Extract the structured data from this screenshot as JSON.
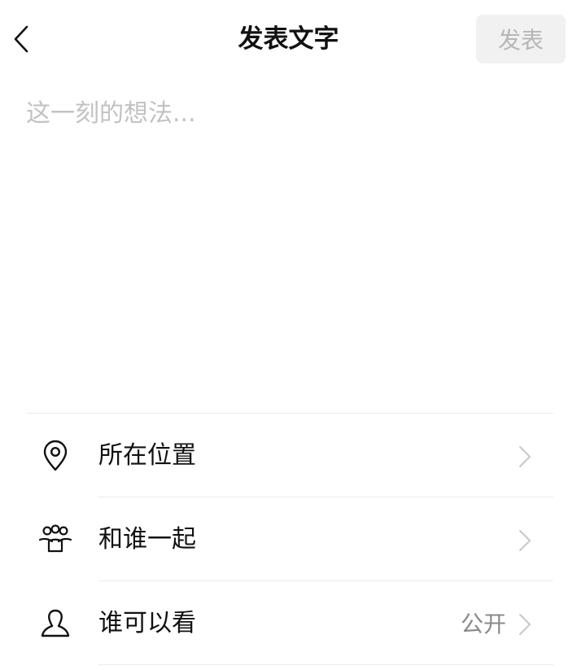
{
  "header": {
    "back_icon": "chevron-left-icon",
    "title": "发表文字",
    "publish_label": "发表"
  },
  "compose": {
    "value": "",
    "placeholder": "这一刻的想法..."
  },
  "options": [
    {
      "icon": "location-pin-icon",
      "label": "所在位置",
      "value": ""
    },
    {
      "icon": "people-group-icon",
      "label": "和谁一起",
      "value": ""
    },
    {
      "icon": "person-icon",
      "label": "谁可以看",
      "value": "公开"
    }
  ],
  "colors": {
    "title_text": "#111111",
    "publish_bg_disabled": "#f1f1f1",
    "publish_text_disabled": "#b6b6b6",
    "placeholder": "#c2c2c2",
    "divider": "#ececec",
    "chevron": "#c8c8c8",
    "secondary_text": "#8a8a8a"
  }
}
